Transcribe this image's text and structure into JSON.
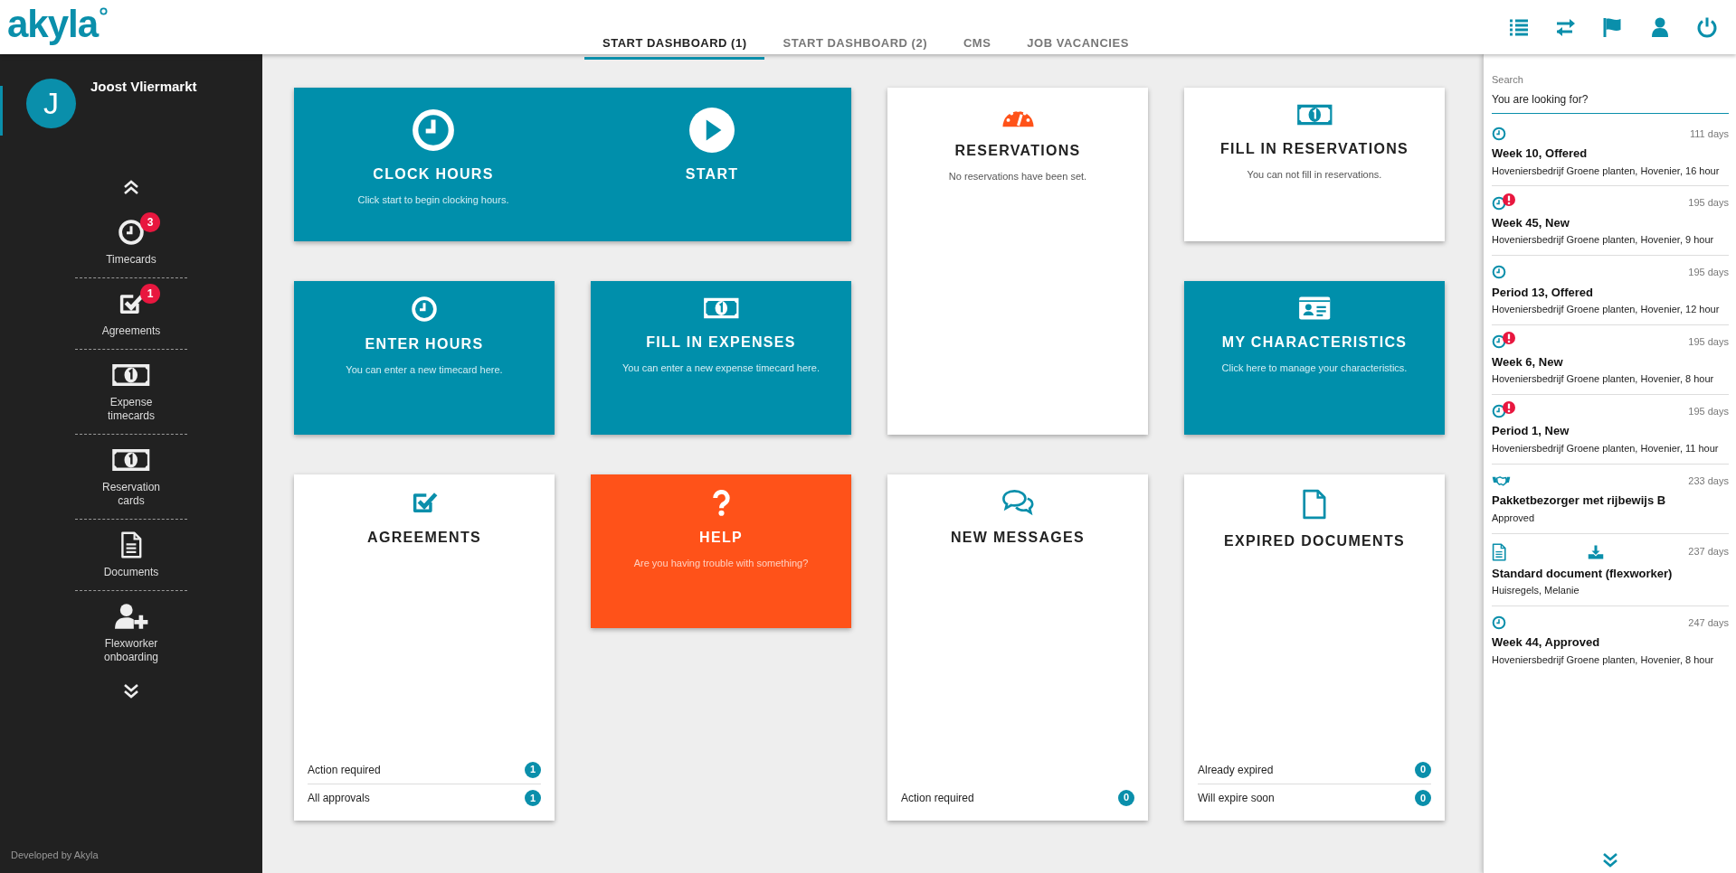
{
  "header": {
    "logo": "akyla",
    "tabs": [
      {
        "label": "START DASHBOARD (1)",
        "selected": true
      },
      {
        "label": "START DASHBOARD (2)",
        "selected": false
      },
      {
        "label": "CMS",
        "selected": false
      },
      {
        "label": "JOB VACANCIES",
        "selected": false
      }
    ]
  },
  "sidebar": {
    "user": {
      "initial": "J",
      "name": "Joost Vliermarkt"
    },
    "items": [
      {
        "label": "Timecards",
        "badge": "3"
      },
      {
        "label": "Agreements",
        "badge": "1"
      },
      {
        "label": "Expense timecards"
      },
      {
        "label": "Reservation cards"
      },
      {
        "label": "Documents"
      },
      {
        "label": "Flexworker onboarding"
      }
    ],
    "footer": "Developed by Akyla"
  },
  "tiles": [
    {
      "kind": "action",
      "title": "CLOCK HOURS",
      "subtitle": "Click start to begin clocking hours.",
      "second_title": "START"
    },
    {
      "kind": "info",
      "title": "RESERVATIONS",
      "subtitle": "No reservations have been set."
    },
    {
      "kind": "info",
      "title": "FILL IN RESERVATIONS",
      "subtitle": "You can not fill in reservations."
    },
    {
      "kind": "action",
      "title": "ENTER HOURS",
      "subtitle": "You can enter a new timecard here."
    },
    {
      "kind": "action",
      "title": "FILL IN EXPENSES",
      "subtitle": "You can enter a new expense timecard here."
    },
    {
      "kind": "action",
      "title": "MY CHARACTERISTICS",
      "subtitle": "Click here to manage your characteristics."
    },
    {
      "kind": "info",
      "title": "AGREEMENTS",
      "stats": [
        {
          "label": "Action required",
          "count": "1"
        },
        {
          "label": "All approvals",
          "count": "1"
        }
      ]
    },
    {
      "kind": "help",
      "title": "HELP",
      "subtitle": "Are you having trouble with something?"
    },
    {
      "kind": "info",
      "title": "NEW MESSAGES",
      "stats": [
        {
          "label": "Action required",
          "count": "0"
        }
      ]
    },
    {
      "kind": "info",
      "title": "EXPIRED DOCUMENTS",
      "stats": [
        {
          "label": "Already expired",
          "count": "0"
        },
        {
          "label": "Will expire soon",
          "count": "0"
        }
      ]
    }
  ],
  "feed": {
    "search": {
      "label": "Search",
      "placeholder": "You are looking for?"
    },
    "items": [
      {
        "kind": "timecard",
        "alert": false,
        "age": "111 days",
        "title": "Week 10, Offered",
        "detail": "Hoveniersbedrijf Groene planten, Hovenier, 16 hour"
      },
      {
        "kind": "timecard",
        "alert": true,
        "age": "195 days",
        "title": "Week 45, New",
        "detail": "Hoveniersbedrijf Groene planten, Hovenier, 9 hour"
      },
      {
        "kind": "timecard",
        "alert": false,
        "age": "195 days",
        "title": "Period 13, Offered",
        "detail": "Hoveniersbedrijf Groene planten, Hovenier, 12 hour"
      },
      {
        "kind": "timecard",
        "alert": true,
        "age": "195 days",
        "title": "Week 6, New",
        "detail": "Hoveniersbedrijf Groene planten, Hovenier, 8 hour"
      },
      {
        "kind": "timecard",
        "alert": true,
        "age": "195 days",
        "title": "Period 1, New",
        "detail": "Hoveniersbedrijf Groene planten, Hovenier, 11 hour"
      },
      {
        "kind": "agreement",
        "alert": false,
        "age": "233 days",
        "title": "Pakketbezorger met rijbewijs B",
        "detail": "Approved"
      },
      {
        "kind": "document",
        "alert": false,
        "age": "237 days",
        "title": "Standard document (flexworker)",
        "detail": "Huisregels, Melanie"
      },
      {
        "kind": "timecard",
        "alert": false,
        "age": "247 days",
        "title": "Week 44, Approved",
        "detail": "Hoveniersbedrijf Groene planten, Hovenier, 8 hour"
      }
    ]
  }
}
